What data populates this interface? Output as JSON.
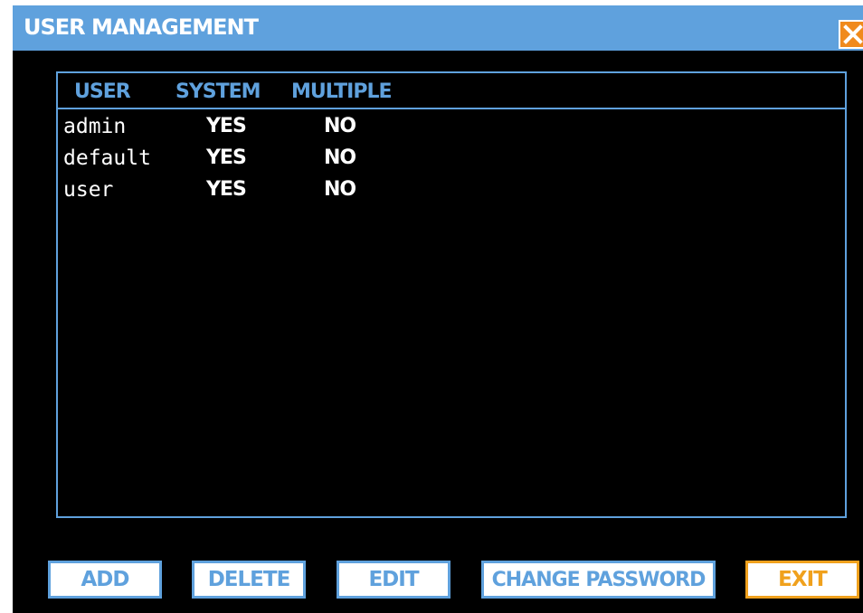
{
  "window": {
    "title": "USER MANAGEMENT",
    "close_icon": "close-x-icon"
  },
  "table": {
    "columns": [
      "USER",
      "SYSTEM",
      "MULTIPLE"
    ],
    "rows": [
      {
        "user": "admin",
        "system": "YES",
        "multiple": "NO"
      },
      {
        "user": "default",
        "system": "YES",
        "multiple": "NO"
      },
      {
        "user": "user",
        "system": "YES",
        "multiple": "NO"
      }
    ]
  },
  "buttons": {
    "add": "ADD",
    "delete": "DELETE",
    "edit": "EDIT",
    "change_password": "CHANGE PASSWORD",
    "exit": "EXIT"
  },
  "colors": {
    "accent": "#5fa1dd",
    "exit": "#f0a11d",
    "close": "#f08a1d",
    "background": "#000000"
  }
}
